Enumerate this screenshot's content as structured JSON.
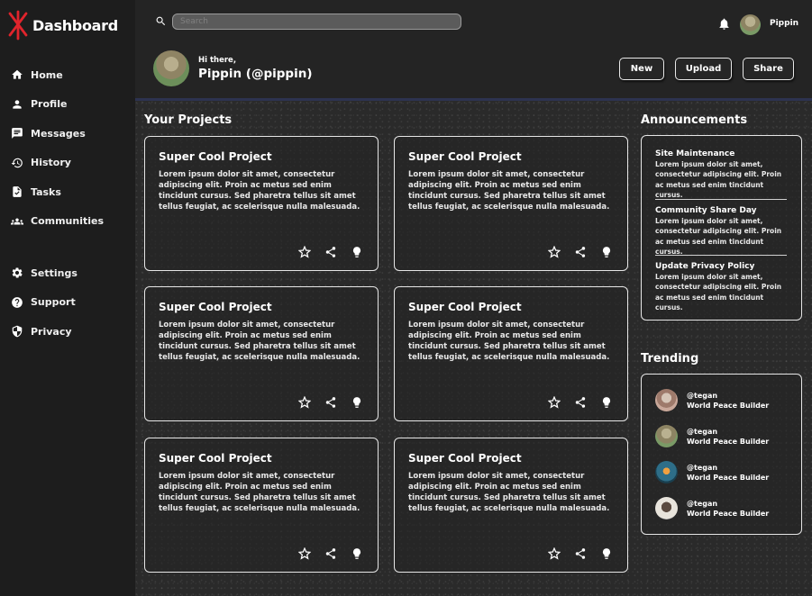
{
  "app": {
    "title": "Dashboard",
    "brand_color": "#e0242c"
  },
  "sidebar": {
    "main_items": [
      {
        "label": "Home",
        "icon": "home-icon"
      },
      {
        "label": "Profile",
        "icon": "person-icon"
      },
      {
        "label": "Messages",
        "icon": "chat-icon"
      },
      {
        "label": "History",
        "icon": "history-icon"
      },
      {
        "label": "Tasks",
        "icon": "task-icon"
      },
      {
        "label": "Communities",
        "icon": "group-icon"
      }
    ],
    "secondary_items": [
      {
        "label": "Settings",
        "icon": "gear-icon"
      },
      {
        "label": "Support",
        "icon": "help-icon"
      },
      {
        "label": "Privacy",
        "icon": "shield-icon"
      }
    ]
  },
  "header": {
    "search_placeholder": "Search",
    "user_short": "Pippin",
    "greeting": "Hi there,",
    "username": "Pippin (@pippin)",
    "buttons": {
      "new": "New",
      "upload": "Upload",
      "share": "Share"
    }
  },
  "projects": {
    "title": "Your Projects",
    "cards": [
      {
        "title": "Super Cool Project",
        "body": "Lorem ipsum dolor sit amet, consectetur adipiscing elit. Proin ac metus sed enim tincidunt cursus. Sed pharetra tellus sit amet tellus feugiat, ac scelerisque nulla malesuada."
      },
      {
        "title": "Super Cool Project",
        "body": "Lorem ipsum dolor sit amet, consectetur adipiscing elit. Proin ac metus sed enim tincidunt cursus. Sed pharetra tellus sit amet tellus feugiat, ac scelerisque nulla malesuada."
      },
      {
        "title": "Super Cool Project",
        "body": "Lorem ipsum dolor sit amet, consectetur adipiscing elit. Proin ac metus sed enim tincidunt cursus. Sed pharetra tellus sit amet tellus feugiat, ac scelerisque nulla malesuada."
      },
      {
        "title": "Super Cool Project",
        "body": "Lorem ipsum dolor sit amet, consectetur adipiscing elit. Proin ac metus sed enim tincidunt cursus. Sed pharetra tellus sit amet tellus feugiat, ac scelerisque nulla malesuada."
      },
      {
        "title": "Super Cool Project",
        "body": "Lorem ipsum dolor sit amet, consectetur adipiscing elit. Proin ac metus sed enim tincidunt cursus. Sed pharetra tellus sit amet tellus feugiat, ac scelerisque nulla malesuada."
      },
      {
        "title": "Super Cool Project",
        "body": "Lorem ipsum dolor sit amet, consectetur adipiscing elit. Proin ac metus sed enim tincidunt cursus. Sed pharetra tellus sit amet tellus feugiat, ac scelerisque nulla malesuada."
      }
    ]
  },
  "announcements": {
    "title": "Announcements",
    "items": [
      {
        "title": "Site Maintenance",
        "body": "Lorem ipsum dolor sit amet, consectetur adipiscing elit. Proin ac metus sed enim tincidunt cursus."
      },
      {
        "title": "Community Share Day",
        "body": "Lorem ipsum dolor sit amet, consectetur adipiscing elit. Proin ac metus sed enim tincidunt cursus."
      },
      {
        "title": "Update Privacy Policy",
        "body": "Lorem ipsum dolor sit amet, consectetur adipiscing elit. Proin ac metus sed enim tincidunt cursus."
      }
    ]
  },
  "trending": {
    "title": "Trending",
    "items": [
      {
        "handle": "@tegan",
        "subtitle": "World Peace Builder"
      },
      {
        "handle": "@tegan",
        "subtitle": "World Peace Builder"
      },
      {
        "handle": "@tegan",
        "subtitle": "World Peace Builder"
      },
      {
        "handle": "@tegan",
        "subtitle": "World Peace Builder"
      }
    ]
  }
}
